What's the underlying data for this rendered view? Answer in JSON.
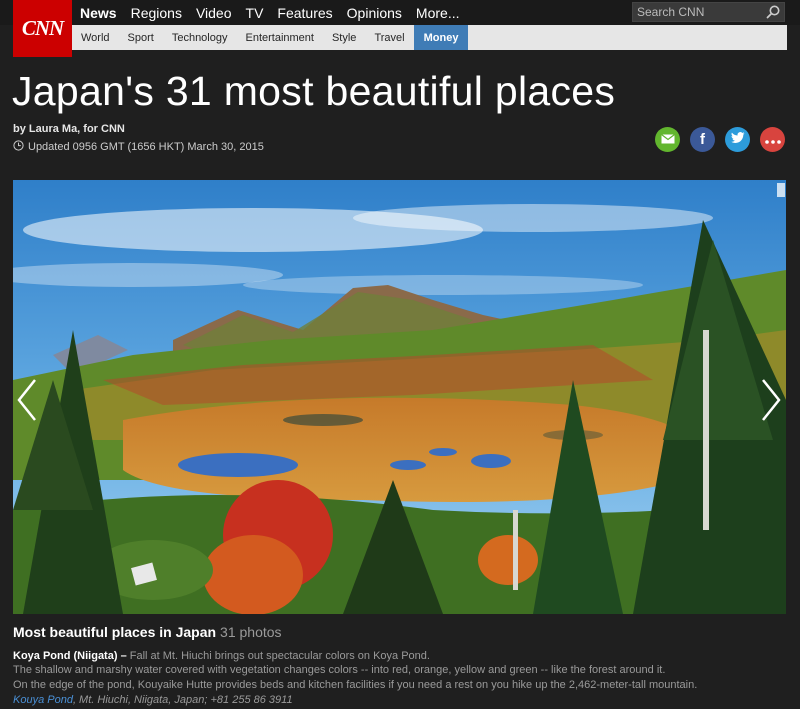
{
  "brand": {
    "logo_text": "CNN",
    "color": "#cc0000"
  },
  "main_nav": {
    "items": [
      {
        "label": "News",
        "active": true
      },
      {
        "label": "Regions"
      },
      {
        "label": "Video"
      },
      {
        "label": "TV"
      },
      {
        "label": "Features"
      },
      {
        "label": "Opinions"
      },
      {
        "label": "More..."
      }
    ]
  },
  "search": {
    "placeholder": "Search CNN",
    "icon": "search-icon"
  },
  "sub_nav": {
    "items": [
      {
        "label": "World"
      },
      {
        "label": "Sport"
      },
      {
        "label": "Technology"
      },
      {
        "label": "Entertainment"
      },
      {
        "label": "Style"
      },
      {
        "label": "Travel"
      },
      {
        "label": "Money",
        "active": true
      }
    ],
    "active_color": "#3f7cb6"
  },
  "article": {
    "headline": "Japan's 31 most beautiful places",
    "byline": "by Laura Ma, for CNN",
    "updated": "Updated 0956 GMT (1656 HKT) March 30, 2015"
  },
  "share": [
    {
      "name": "email",
      "icon": "envelope-icon",
      "color": "#62b62e"
    },
    {
      "name": "facebook",
      "icon": "facebook-icon",
      "color": "#3b5998"
    },
    {
      "name": "twitter",
      "icon": "twitter-icon",
      "color": "#2d9cdb"
    },
    {
      "name": "more",
      "icon": "more-dots-icon",
      "color": "#d8443e"
    }
  ],
  "gallery": {
    "title": "Most beautiful places in Japan",
    "count": "31 photos",
    "caption_title": "Koya Pond (Niigata)",
    "caption_dash": " – ",
    "caption_line1": "Fall at Mt. Hiuchi brings out spectacular colors on Koya Pond.",
    "caption_line2": "The shallow and marshy water covered with vegetation changes colors -- into red, orange, yellow and green -- like the forest around it.",
    "caption_line3": "On the edge of the pond, Kouyaike Hutte provides beds and kitchen facilities if you need a rest on you hike up the 2,462-meter-tall mountain.",
    "link_text": "Kouya Pond",
    "location": ", Mt. Hiuchi, Niigata, Japan; +81 255 86 3911",
    "link_color": "#4a90d6"
  }
}
